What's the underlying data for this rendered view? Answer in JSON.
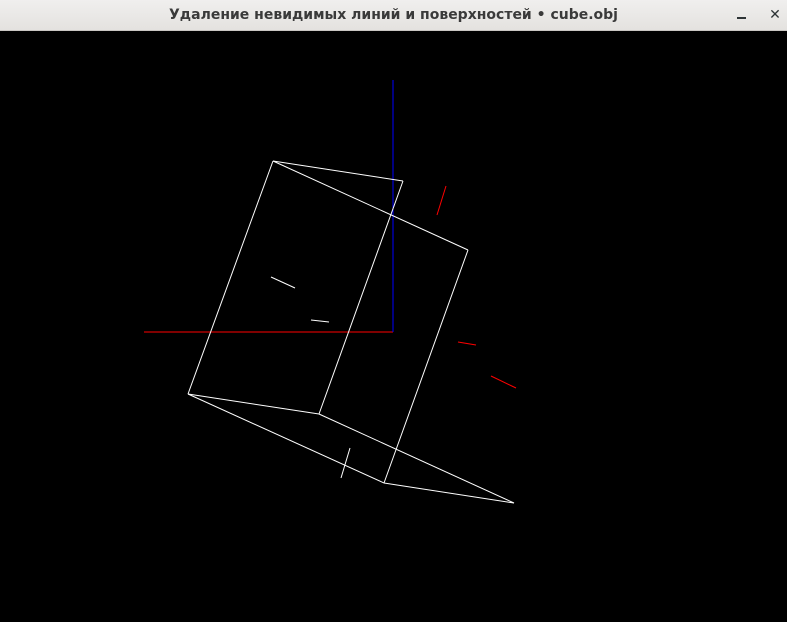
{
  "window": {
    "title": "Удаление невидимых линий и поверхностей • cube.obj",
    "minimize_label": "",
    "close_label": "✕"
  },
  "scene": {
    "background_color": "#000000",
    "model_color": "#ffffff",
    "axis_x_color": "#ff0000",
    "axis_y_color": "#0000ff"
  }
}
